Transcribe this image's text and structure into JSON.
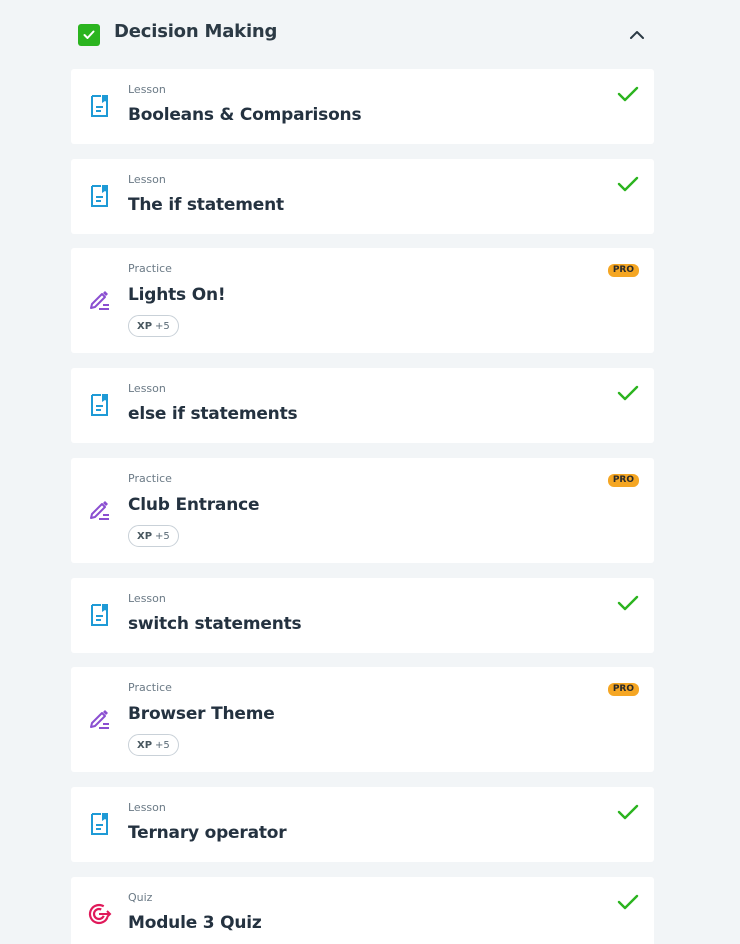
{
  "module": {
    "title": "Decision Making",
    "completed": true,
    "expanded": true
  },
  "colors": {
    "lesson_icon": "#1e9ad6",
    "practice_icon": "#8b4fd1",
    "quiz_icon": "#e0195a",
    "check": "#2bb41f",
    "pro_badge": "#f5a623"
  },
  "items": [
    {
      "type": "Lesson",
      "title": "Booleans & Comparisons",
      "icon": "lesson-icon",
      "status": "completed"
    },
    {
      "type": "Lesson",
      "title": "The if statement",
      "icon": "lesson-icon",
      "status": "completed"
    },
    {
      "type": "Practice",
      "title": "Lights On!",
      "icon": "practice-icon",
      "status": "pro",
      "badge": "PRO",
      "xp_label": "XP",
      "xp_value": "+5"
    },
    {
      "type": "Lesson",
      "title": "else if statements",
      "icon": "lesson-icon",
      "status": "completed"
    },
    {
      "type": "Practice",
      "title": "Club Entrance",
      "icon": "practice-icon",
      "status": "pro",
      "badge": "PRO",
      "xp_label": "XP",
      "xp_value": "+5"
    },
    {
      "type": "Lesson",
      "title": "switch statements",
      "icon": "lesson-icon",
      "status": "completed"
    },
    {
      "type": "Practice",
      "title": "Browser Theme",
      "icon": "practice-icon",
      "status": "pro",
      "badge": "PRO",
      "xp_label": "XP",
      "xp_value": "+5"
    },
    {
      "type": "Lesson",
      "title": "Ternary operator",
      "icon": "lesson-icon",
      "status": "completed"
    },
    {
      "type": "Quiz",
      "title": "Module 3 Quiz",
      "icon": "quiz-icon",
      "status": "completed"
    }
  ]
}
